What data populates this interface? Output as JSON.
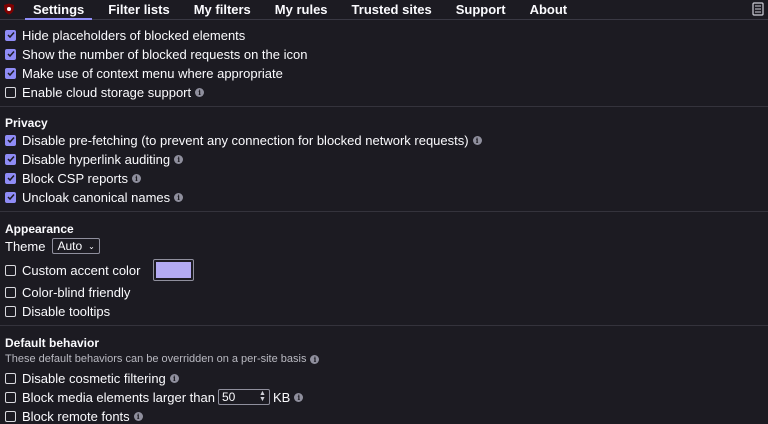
{
  "tabs": [
    "Settings",
    "Filter lists",
    "My filters",
    "My rules",
    "Trusted sites",
    "Support",
    "About"
  ],
  "general": [
    {
      "label": "Hide placeholders of blocked elements",
      "checked": true,
      "info": false
    },
    {
      "label": "Show the number of blocked requests on the icon",
      "checked": true,
      "info": false
    },
    {
      "label": "Make use of context menu where appropriate",
      "checked": true,
      "info": false
    },
    {
      "label": "Enable cloud storage support",
      "checked": false,
      "info": true
    }
  ],
  "privacy": {
    "heading": "Privacy",
    "items": [
      {
        "label": "Disable pre-fetching (to prevent any connection for blocked network requests)",
        "checked": true,
        "info": true
      },
      {
        "label": "Disable hyperlink auditing",
        "checked": true,
        "info": true
      },
      {
        "label": "Block CSP reports",
        "checked": true,
        "info": true
      },
      {
        "label": "Uncloak canonical names",
        "checked": true,
        "info": true
      }
    ]
  },
  "appearance": {
    "heading": "Appearance",
    "theme_label": "Theme",
    "theme_value": "Auto",
    "accent_label": "Custom accent color",
    "accent_color": "#b3aaf3",
    "colorblind_label": "Color-blind friendly",
    "tooltips_label": "Disable tooltips"
  },
  "default_behavior": {
    "heading": "Default behavior",
    "note": "These default behaviors can be overridden on a per-site basis",
    "cosmetic_label": "Disable cosmetic filtering",
    "media_label": "Block media elements larger than",
    "media_value": "50",
    "media_unit": "KB",
    "fonts_label": "Block remote fonts"
  },
  "colors": {
    "accent": "#8f8cf6",
    "background": "#1c1b22"
  },
  "icons": [
    "ublock-logo-icon",
    "book-icon",
    "info-icon",
    "checkmark-icon",
    "chevron-down-icon"
  ]
}
